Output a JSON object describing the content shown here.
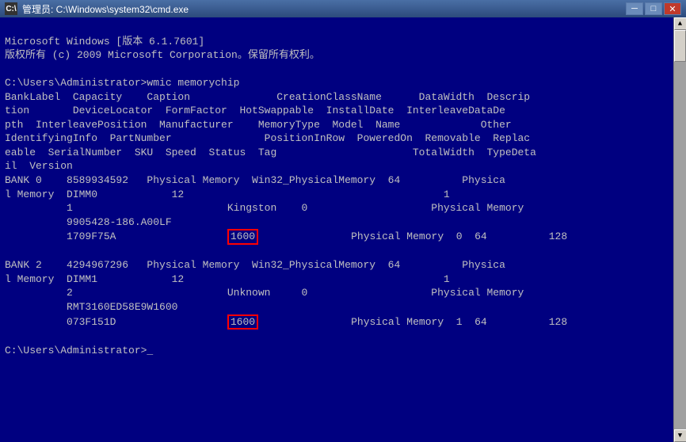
{
  "titlebar": {
    "icon": "C:\\",
    "text": "管理员: C:\\Windows\\system32\\cmd.exe",
    "minimize": "─",
    "maximize": "□",
    "close": "✕"
  },
  "content": {
    "line1": "Microsoft Windows [版本 6.1.7601]",
    "line2": "版权所有 (c) 2009 Microsoft Corporation。保留所有权利。",
    "line3": "",
    "line4": "C:\\Users\\Administrator>wmic memorychip",
    "line5": "BankLabel  Capacity    Caption              CreationClassName      DataWidth  Descrip",
    "line6": "tion       DeviceLocator  FormFactor  HotSwappable  InstallDate  InterleaveDataDe",
    "line7": "pth  InterleavePosition  Manufacturer    MemoryType  Model  Name             Other",
    "line8": "IdentifyingInfo  PartNumber               PositionInRow  PoweredOn  Removable  Replac",
    "line9": "eable  SerialNumber  SKU  Speed  Status  Tag                      TotalWidth  TypeDeta",
    "line10": "il  Version",
    "bank0_line1": "BANK 0    8589934592   Physical Memory  Win32_PhysicalMemory  64          Physica",
    "bank0_line2": "l Memory  DIMM0            12                                          1",
    "bank0_line3": "          1                         Kingston    0                    Physical Memory",
    "bank0_line4": "          9905428-186.A00LF",
    "bank0_line5": "          1709F75A                  ",
    "bank0_speed": "1600",
    "bank0_line5b": "               Physical Memory  0  64          128",
    "bank1_gap": "",
    "bank2_line1": "BANK 2    4294967296   Physical Memory  Win32_PhysicalMemory  64          Physica",
    "bank2_line2": "l Memory  DIMM1            12                                          1",
    "bank2_line3": "          2                         Unknown     0                    Physical Memory",
    "bank2_line4": "          RMT3160ED58E9W1600",
    "bank2_line5": "          073F151D                  ",
    "bank2_speed": "1600",
    "bank2_line5b": "               Physical Memory  1  64          128",
    "prompt": "",
    "prompt_line": "C:\\Users\\Administrator>_"
  }
}
